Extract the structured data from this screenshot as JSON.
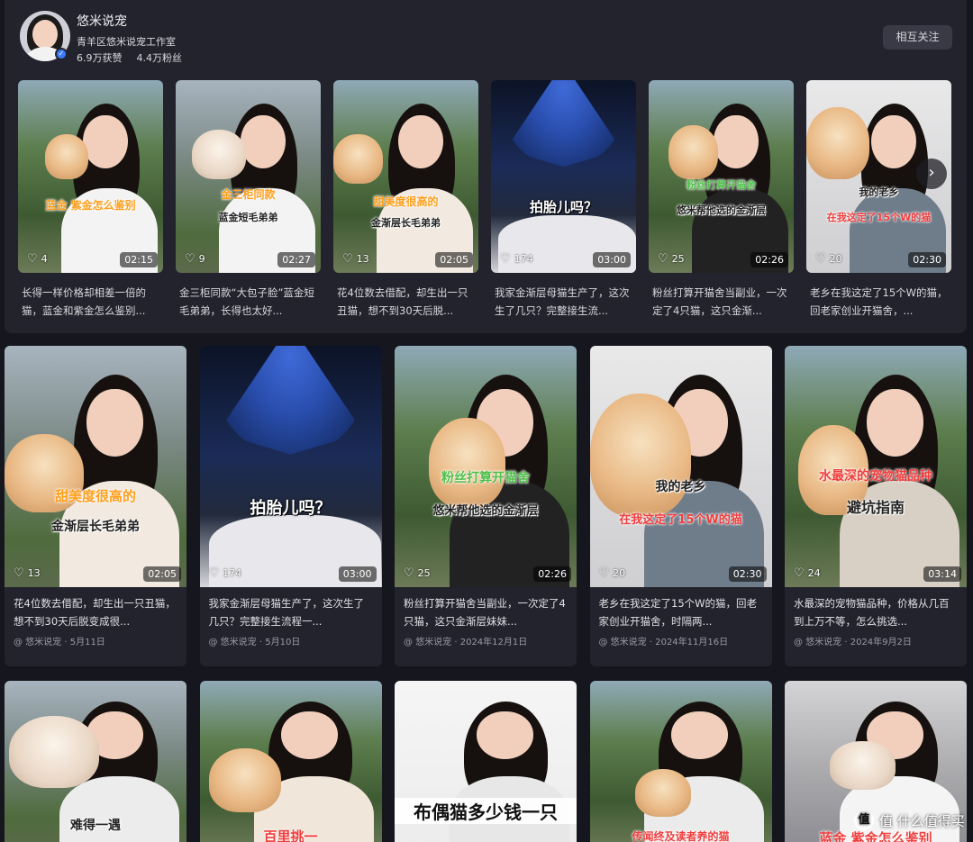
{
  "profile": {
    "nickname": "悠米说宠",
    "studio": "青羊区悠米说宠工作室",
    "likes": "6.9万获赞",
    "followers": "4.4万粉丝",
    "mutual_button": "相互关注"
  },
  "mini_videos": [
    {
      "caption1": "蓝金 紫金怎么鉴别",
      "caption2": "",
      "likes": "4",
      "duration": "02:15",
      "title": "长得一样价格却相差一倍的猫，蓝金和紫金怎么鉴别..."
    },
    {
      "caption1": "金三柜同款",
      "caption2": "蓝金短毛弟弟",
      "likes": "9",
      "duration": "02:27",
      "title": "金三柜同款“大包子脸”蓝金短毛弟弟，长得也太好..."
    },
    {
      "caption1": "甜美度很高的",
      "caption2": "金渐层长毛弟弟",
      "likes": "13",
      "duration": "02:05",
      "title": "花4位数去借配，却生出一只丑猫，想不到30天后脱..."
    },
    {
      "caption1": "拍胎儿吗？",
      "caption2": "",
      "likes": "174",
      "duration": "03:00",
      "title": "我家金渐层母猫生产了，这次生了几只？完整接生流..."
    },
    {
      "caption1": "粉丝打算开猫舍",
      "caption2": "悠米帮他选的金渐层",
      "likes": "25",
      "duration": "02:26",
      "title": "粉丝打算开猫舍当副业，一次定了4只猫，这只金渐..."
    },
    {
      "caption1": "我的老乡",
      "caption2": "在我这定了15个W的猫",
      "likes": "20",
      "duration": "02:30",
      "title": "老乡在我这定了15个W的猫，回老家创业开猫舍，..."
    }
  ],
  "videos": [
    {
      "caption1": "甜美度很高的",
      "caption2": "金渐层长毛弟弟",
      "likes": "13",
      "duration": "02:05",
      "title": "花4位数去借配，却生出一只丑猫，想不到30天后脱变成很...",
      "meta": "@ 悠米说宠 · 5月11日"
    },
    {
      "caption1": "拍胎儿吗？",
      "caption2": "",
      "likes": "174",
      "duration": "03:00",
      "title": "我家金渐层母猫生产了，这次生了几只？完整接生流程一...",
      "meta": "@ 悠米说宠 · 5月10日"
    },
    {
      "caption1": "粉丝打算开猫舍",
      "caption2": "悠米帮他选的金渐层",
      "likes": "25",
      "duration": "02:26",
      "title": "粉丝打算开猫舍当副业，一次定了4只猫，这只金渐层妹妹...",
      "meta": "@ 悠米说宠 · 2024年12月1日"
    },
    {
      "caption1": "我的老乡",
      "caption2": "在我这定了15个W的猫",
      "likes": "20",
      "duration": "02:30",
      "title": "老乡在我这定了15个W的猫，回老家创业开猫舍，时隔两...",
      "meta": "@ 悠米说宠 · 2024年11月16日"
    },
    {
      "caption1": "水最深的宠物猫品种",
      "caption2": "避坑指南",
      "likes": "24",
      "duration": "03:14",
      "title": "水最深的宠物猫品种，价格从几百到上万不等，怎么挑选...",
      "meta": "@ 悠米说宠 · 2024年9月2日"
    },
    {
      "caption1": "难得一遇",
      "caption2": ""
    },
    {
      "caption1": "百里挑一",
      "caption2": ""
    },
    {
      "caption1": "布偶猫多少钱一只",
      "caption2": ""
    },
    {
      "caption1": "传闻终及读者养的猫",
      "caption2": ""
    },
    {
      "caption1": "蓝金 紫金怎么鉴别",
      "caption2": ""
    }
  ],
  "watermark": "值 什么值得买",
  "icons": {
    "heart": "heart-icon",
    "next": "chevron-right-icon",
    "verify": "verified-icon"
  }
}
